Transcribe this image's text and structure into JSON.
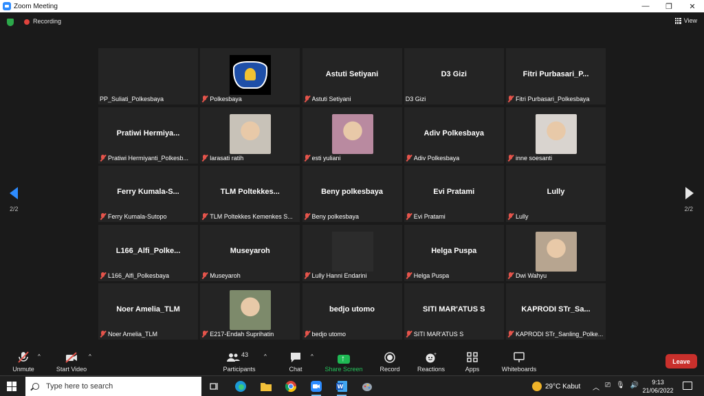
{
  "window": {
    "title": "Zoom Meeting"
  },
  "topbar": {
    "recording_label": "Recording",
    "view_label": "View"
  },
  "pager": {
    "left": "2/2",
    "right": "2/2"
  },
  "tiles": [
    {
      "big": "",
      "label": "PP_Suliati_Polkesbaya",
      "muted": false,
      "kind": "dark"
    },
    {
      "big": "",
      "label": "Polkesbaya",
      "muted": true,
      "kind": "logo"
    },
    {
      "big": "Astuti Setiyani",
      "label": "Astuti Setiyani",
      "muted": true,
      "kind": "name"
    },
    {
      "big": "D3 Gizi",
      "label": "D3 Gizi",
      "muted": false,
      "kind": "name"
    },
    {
      "big": "Fitri  Purbasari_P...",
      "label": "Fitri Purbasari_Polkesbaya",
      "muted": true,
      "kind": "name"
    },
    {
      "big": "Pratiwi  Hermiya...",
      "label": "Pratiwi Hermiyanti_Polkesb...",
      "muted": true,
      "kind": "name"
    },
    {
      "big": "",
      "label": "larasati ratih",
      "muted": true,
      "kind": "photo",
      "color": "#c8c2b8"
    },
    {
      "big": "",
      "label": "esti yuliani",
      "muted": true,
      "kind": "photo",
      "color": "#b98aa0"
    },
    {
      "big": "Adiv Polkesbaya",
      "label": "Adiv Polkesbaya",
      "muted": true,
      "kind": "name"
    },
    {
      "big": "",
      "label": "inne soesanti",
      "muted": true,
      "kind": "photo",
      "color": "#d9d4cf"
    },
    {
      "big": "Ferry  Kumala-S...",
      "label": "Ferry Kumala-Sutopo",
      "muted": true,
      "kind": "name"
    },
    {
      "big": "TLM  Poltekkes...",
      "label": "TLM Poltekkes Kemenkes S...",
      "muted": true,
      "kind": "name"
    },
    {
      "big": "Beny polkesbaya",
      "label": "Beny polkesbaya",
      "muted": true,
      "kind": "name"
    },
    {
      "big": "Evi Pratami",
      "label": "Evi Pratami",
      "muted": true,
      "kind": "name"
    },
    {
      "big": "Lully",
      "label": "Lully",
      "muted": true,
      "kind": "name"
    },
    {
      "big": "L166_Alfi_Polke...",
      "label": "L166_Alfi_Polkesbaya",
      "muted": true,
      "kind": "name"
    },
    {
      "big": "Museyaroh",
      "label": "Museyaroh",
      "muted": true,
      "kind": "name"
    },
    {
      "big": "",
      "label": "Lully Hanni Endarini",
      "muted": true,
      "kind": "dark"
    },
    {
      "big": "Helga Puspa",
      "label": "Helga Puspa",
      "muted": true,
      "kind": "name"
    },
    {
      "big": "",
      "label": "Dwi Wahyu",
      "muted": true,
      "kind": "photo",
      "color": "#b7a590"
    },
    {
      "big": "Noer Amelia_TLM",
      "label": "Noer Amelia_TLM",
      "muted": true,
      "kind": "name"
    },
    {
      "big": "",
      "label": "E217-Endah Suprihatin",
      "muted": true,
      "kind": "photo",
      "color": "#7d8a6b"
    },
    {
      "big": "bedjo utomo",
      "label": "bedjo utomo",
      "muted": true,
      "kind": "name"
    },
    {
      "big": "SITI MAR'ATUS S",
      "label": "SITI MAR'ATUS S",
      "muted": true,
      "kind": "name"
    },
    {
      "big": "KAPRODI  STr_Sa...",
      "label": "KAPRODI STr_Sanling_Polke...",
      "muted": true,
      "kind": "name"
    }
  ],
  "toolbar": {
    "unmute": "Unmute",
    "start_video": "Start Video",
    "participants": "Participants",
    "participants_count": "43",
    "chat": "Chat",
    "share_screen": "Share Screen",
    "record": "Record",
    "reactions": "Reactions",
    "apps": "Apps",
    "whiteboards": "Whiteboards",
    "leave": "Leave"
  },
  "taskbar": {
    "search_placeholder": "Type here to search",
    "weather": "29°C  Kabut",
    "time": "9:13",
    "date": "21/06/2022"
  }
}
